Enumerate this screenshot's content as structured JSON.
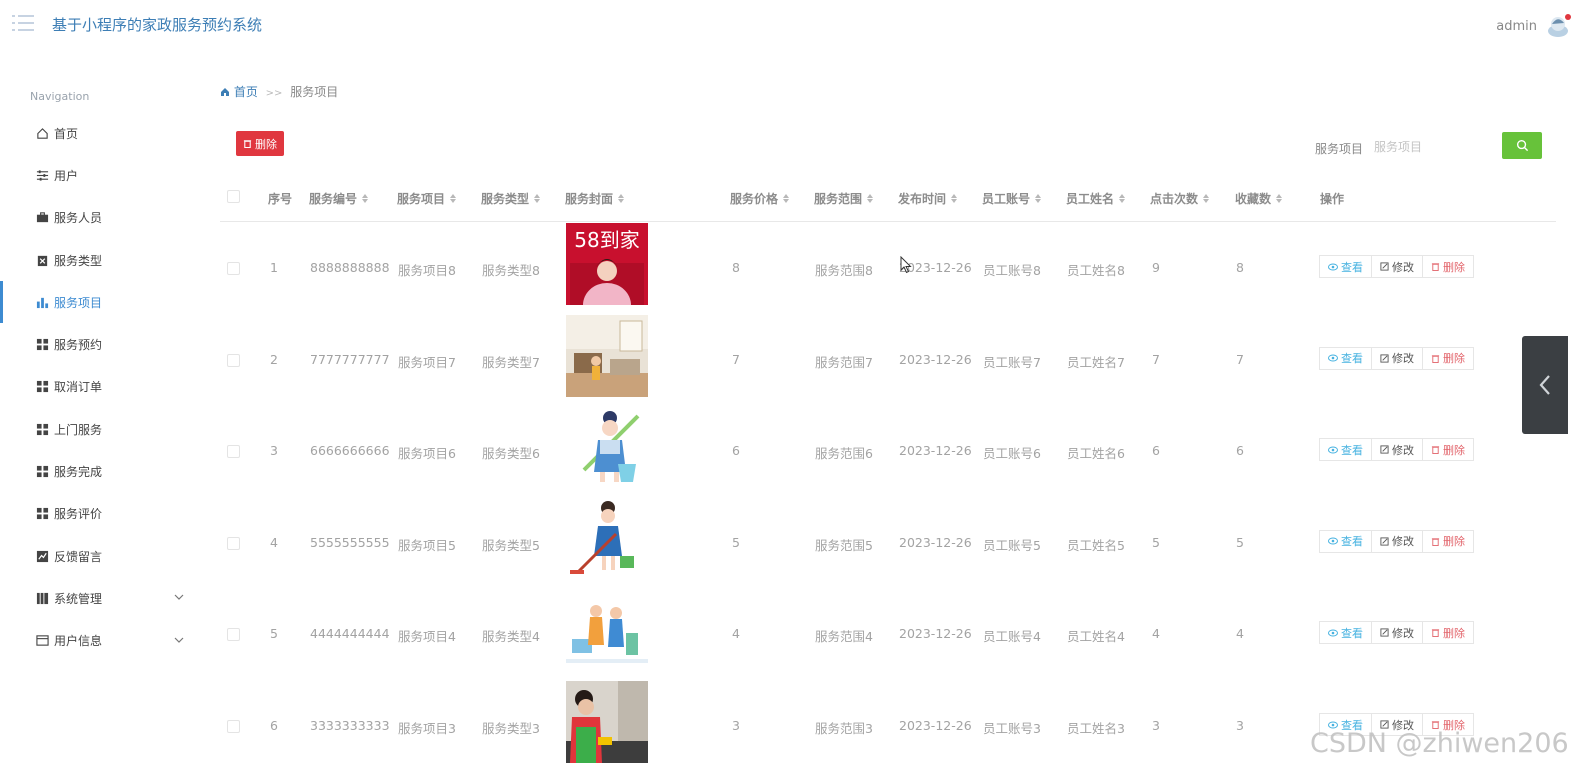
{
  "header": {
    "title": "基于小程序的家政服务预约系统",
    "user": "admin"
  },
  "sidebar": {
    "heading": "Navigation",
    "items": [
      {
        "label": "首页",
        "icon": "home-icon"
      },
      {
        "label": "用户",
        "icon": "sliders-icon"
      },
      {
        "label": "服务人员",
        "icon": "briefcase-icon"
      },
      {
        "label": "服务类型",
        "icon": "clipboard-icon"
      },
      {
        "label": "服务项目",
        "icon": "bar-chart-icon",
        "active": true
      },
      {
        "label": "服务预约",
        "icon": "grid-icon"
      },
      {
        "label": "取消订单",
        "icon": "grid-icon"
      },
      {
        "label": "上门服务",
        "icon": "grid-icon"
      },
      {
        "label": "服务完成",
        "icon": "grid-icon"
      },
      {
        "label": "服务评价",
        "icon": "grid-icon"
      },
      {
        "label": "反馈留言",
        "icon": "line-chart-icon"
      },
      {
        "label": "系统管理",
        "icon": "book-icon",
        "expandable": true
      },
      {
        "label": "用户信息",
        "icon": "card-icon",
        "expandable": true
      }
    ]
  },
  "breadcrumb": {
    "home": "首页",
    "separator": ">>",
    "current": "服务项目"
  },
  "toolbar": {
    "delete_label": "删除",
    "search_label": "服务项目",
    "search_placeholder": "服务项目",
    "search_value": ""
  },
  "table": {
    "columns": [
      "序号",
      "服务编号",
      "服务项目",
      "服务类型",
      "服务封面",
      "服务价格",
      "服务范围",
      "发布时间",
      "员工账号",
      "员工姓名",
      "点击次数",
      "收藏数",
      "操作"
    ],
    "rows": [
      {
        "index": "1",
        "code": "8888888888",
        "item": "服务项目8",
        "type": "服务类型8",
        "cover_text": "58到家",
        "cover": "sign-photo",
        "price": "8",
        "range": "服务范围8",
        "date": "2023-12-26",
        "account": "员工账号8",
        "name": "员工姓名8",
        "clicks": "9",
        "favorites": "8"
      },
      {
        "index": "2",
        "code": "7777777777",
        "item": "服务项目7",
        "type": "服务类型7",
        "cover_text": "",
        "cover": "living-room-photo",
        "price": "7",
        "range": "服务范围7",
        "date": "2023-12-26",
        "account": "员工账号7",
        "name": "员工姓名7",
        "clicks": "7",
        "favorites": "7"
      },
      {
        "index": "3",
        "code": "6666666666",
        "item": "服务项目6",
        "type": "服务类型6",
        "cover_text": "",
        "cover": "cleaner-cartoon",
        "price": "6",
        "range": "服务范围6",
        "date": "2023-12-26",
        "account": "员工账号6",
        "name": "员工姓名6",
        "clicks": "6",
        "favorites": "6"
      },
      {
        "index": "4",
        "code": "5555555555",
        "item": "服务项目5",
        "type": "服务类型5",
        "cover_text": "",
        "cover": "mop-cartoon",
        "price": "5",
        "range": "服务范围5",
        "date": "2023-12-26",
        "account": "员工账号5",
        "name": "员工姓名5",
        "clicks": "5",
        "favorites": "5"
      },
      {
        "index": "5",
        "code": "4444444444",
        "item": "服务项目4",
        "type": "服务类型4",
        "cover_text": "",
        "cover": "team-cartoon",
        "price": "4",
        "range": "服务范围4",
        "date": "2023-12-26",
        "account": "员工账号4",
        "name": "员工姓名4",
        "clicks": "4",
        "favorites": "4"
      },
      {
        "index": "6",
        "code": "3333333333",
        "item": "服务项目3",
        "type": "服务类型3",
        "cover_text": "",
        "cover": "kitchen-photo",
        "price": "3",
        "range": "服务范围3",
        "date": "2023-12-26",
        "account": "员工账号3",
        "name": "员工姓名3",
        "clicks": "3",
        "favorites": "3"
      }
    ],
    "actions": {
      "view": "查看",
      "edit": "修改",
      "delete": "删除"
    }
  },
  "watermark": "CSDN @zhiwen206",
  "colors": {
    "accent": "#3d8bd1",
    "danger": "#e0373f",
    "success": "#67c23a"
  }
}
